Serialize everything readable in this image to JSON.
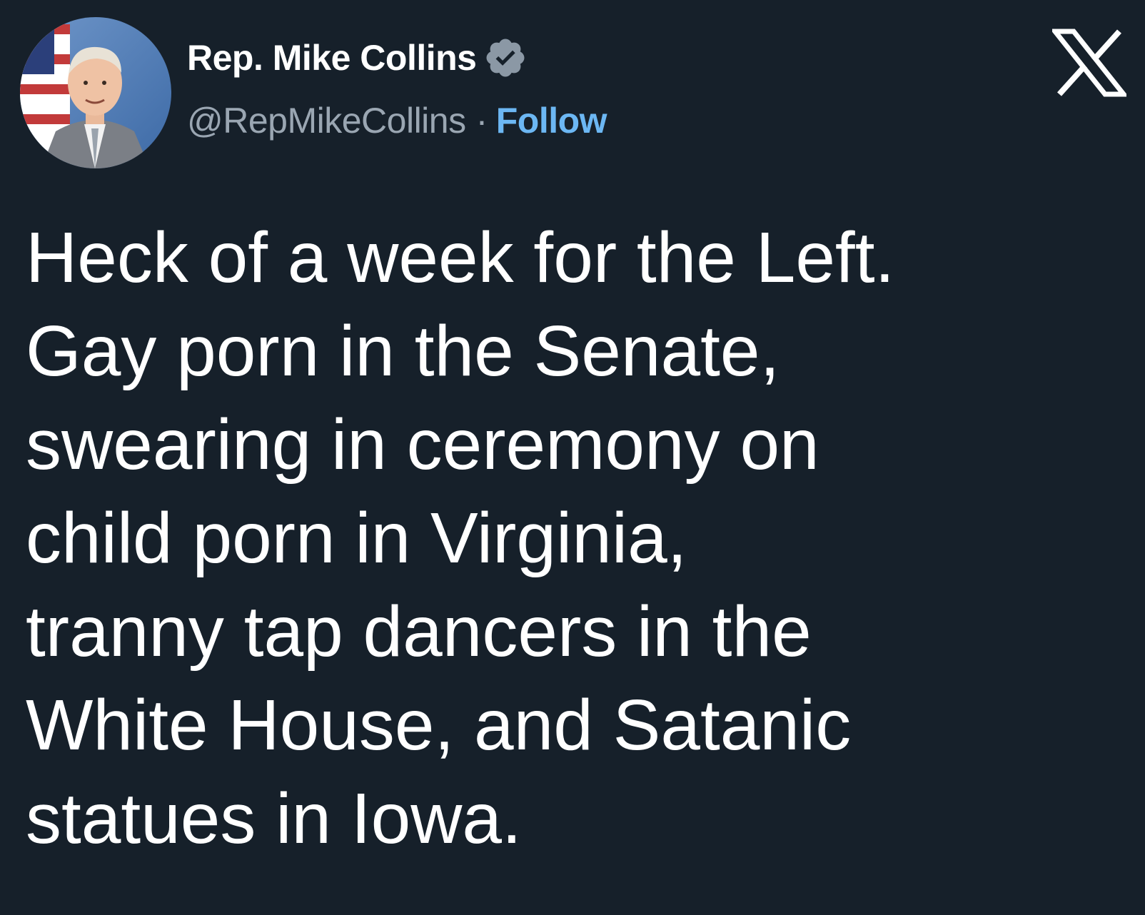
{
  "tweet": {
    "author": {
      "display_name": "Rep. Mike Collins",
      "handle": "@RepMikeCollins",
      "verified": true,
      "verified_icon": "verified-badge-icon"
    },
    "separator": "·",
    "follow_label": "Follow",
    "brand_icon": "x-logo-icon",
    "text_lines": [
      "Heck of a week for the Left.",
      "Gay porn in the Senate,",
      "swearing in ceremony on",
      "child porn in Virginia,",
      "tranny tap dancers in the",
      "White House, and Satanic",
      "statues in Iowa."
    ]
  },
  "colors": {
    "background": "#16202a",
    "text": "#ffffff",
    "handle": "#9aa6b2",
    "follow": "#6cb7f3",
    "badge": "#8b98a5"
  }
}
